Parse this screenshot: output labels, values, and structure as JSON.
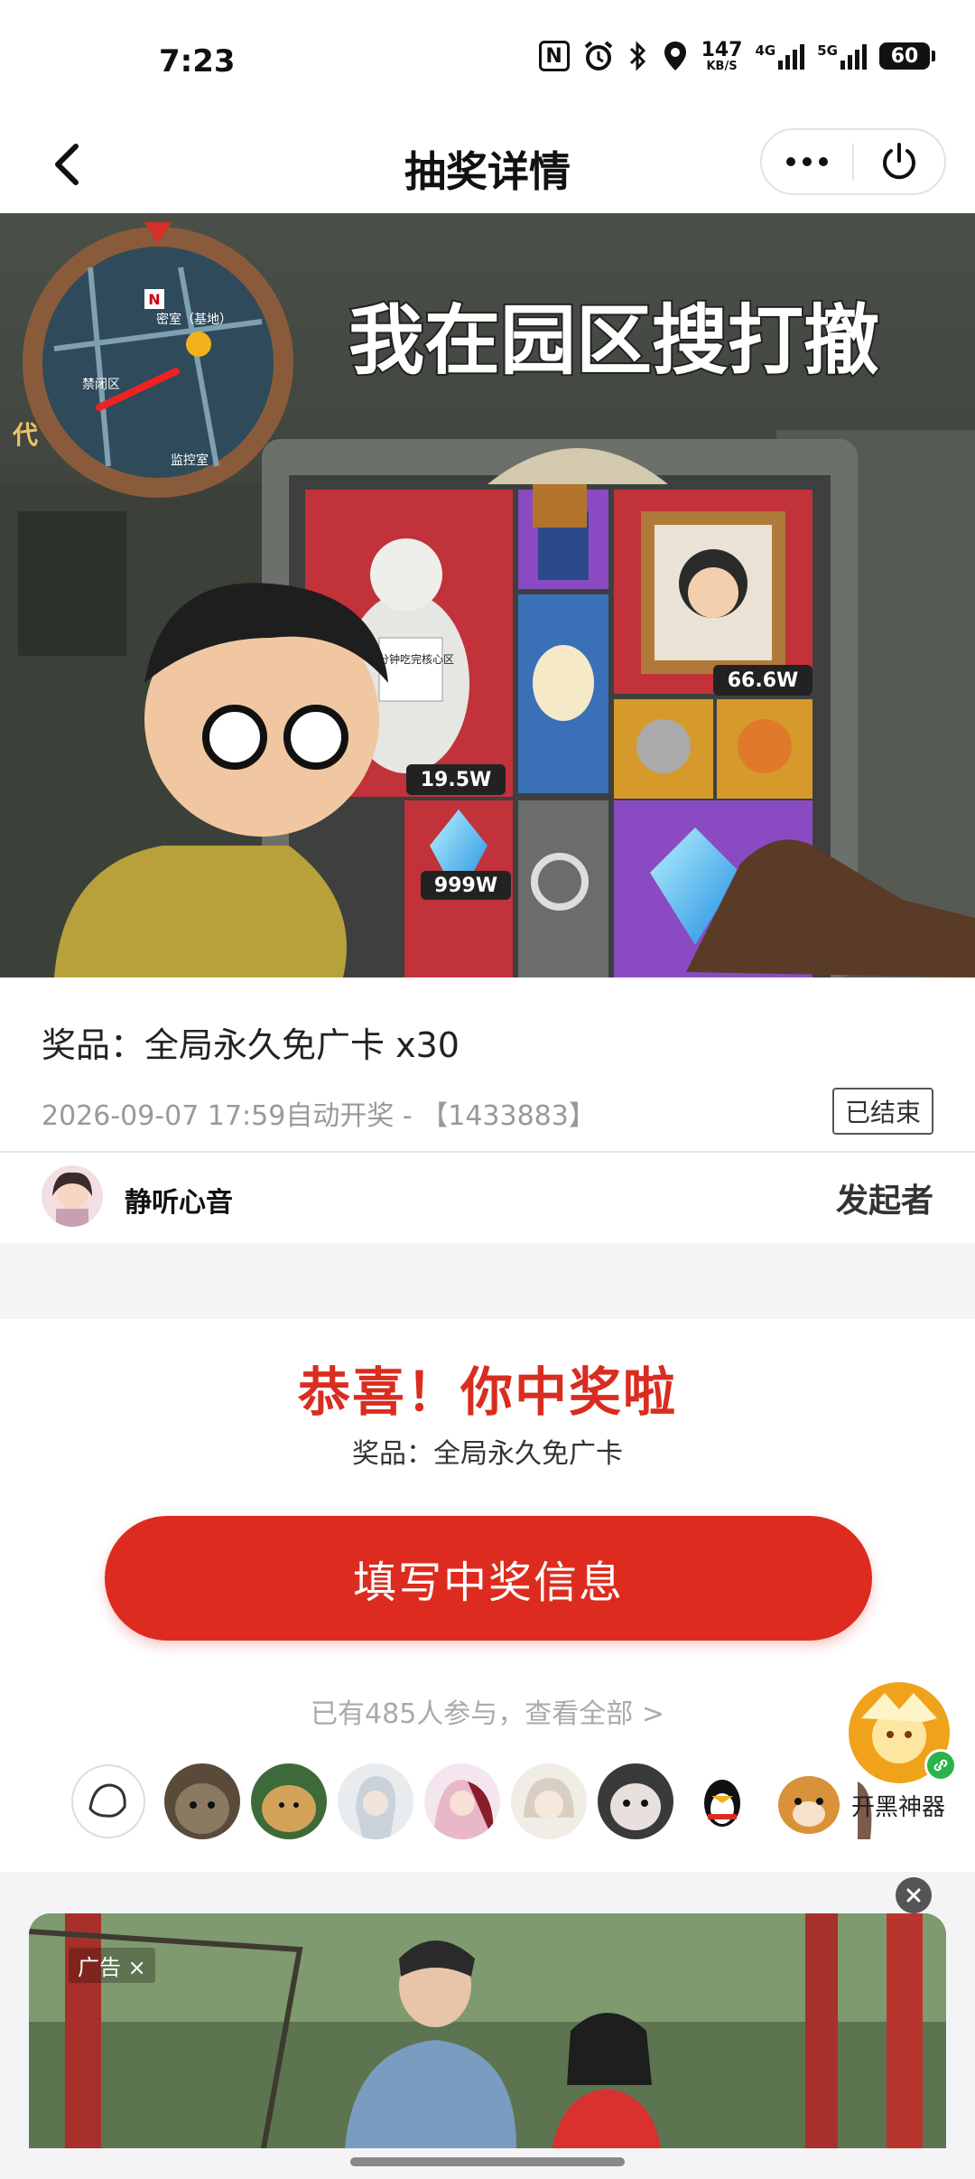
{
  "status_bar": {
    "time": "7:23",
    "nfc": "N",
    "net_speed": "147",
    "net_speed_unit": "KB/S",
    "net_4g": "4G",
    "net_5g": "5G",
    "battery": "60"
  },
  "header": {
    "title": "抽奖详情"
  },
  "banner": {
    "game_title": "我在园区搜打撤",
    "map_label_n": "N",
    "map_label_1": "密室（基地）",
    "map_label_2": "禁闭区",
    "map_label_3": "监控室",
    "side_text": "代",
    "statue_sign": "三分钟吃完核心区",
    "value_1": "66.6W",
    "value_2": "19.5W",
    "value_3": "999W"
  },
  "prize": {
    "title": "奖品：全局永久免广卡 x30",
    "meta": "2026-09-07 17:59自动开奖 - 【1433883】",
    "status": "已结束"
  },
  "creator": {
    "name": "静听心音",
    "role": "发起者"
  },
  "result": {
    "congrats": "恭喜！你中奖啦",
    "prize": "奖品：全局永久免广卡",
    "button": "填写中奖信息",
    "participants": "已有485人参与，查看全部 >"
  },
  "floating": {
    "label": "开黑神器"
  },
  "ad": {
    "tag": "广告 ×"
  },
  "colors": {
    "accent_red": "#dd2c1f",
    "congrats_red": "#d92d20"
  }
}
